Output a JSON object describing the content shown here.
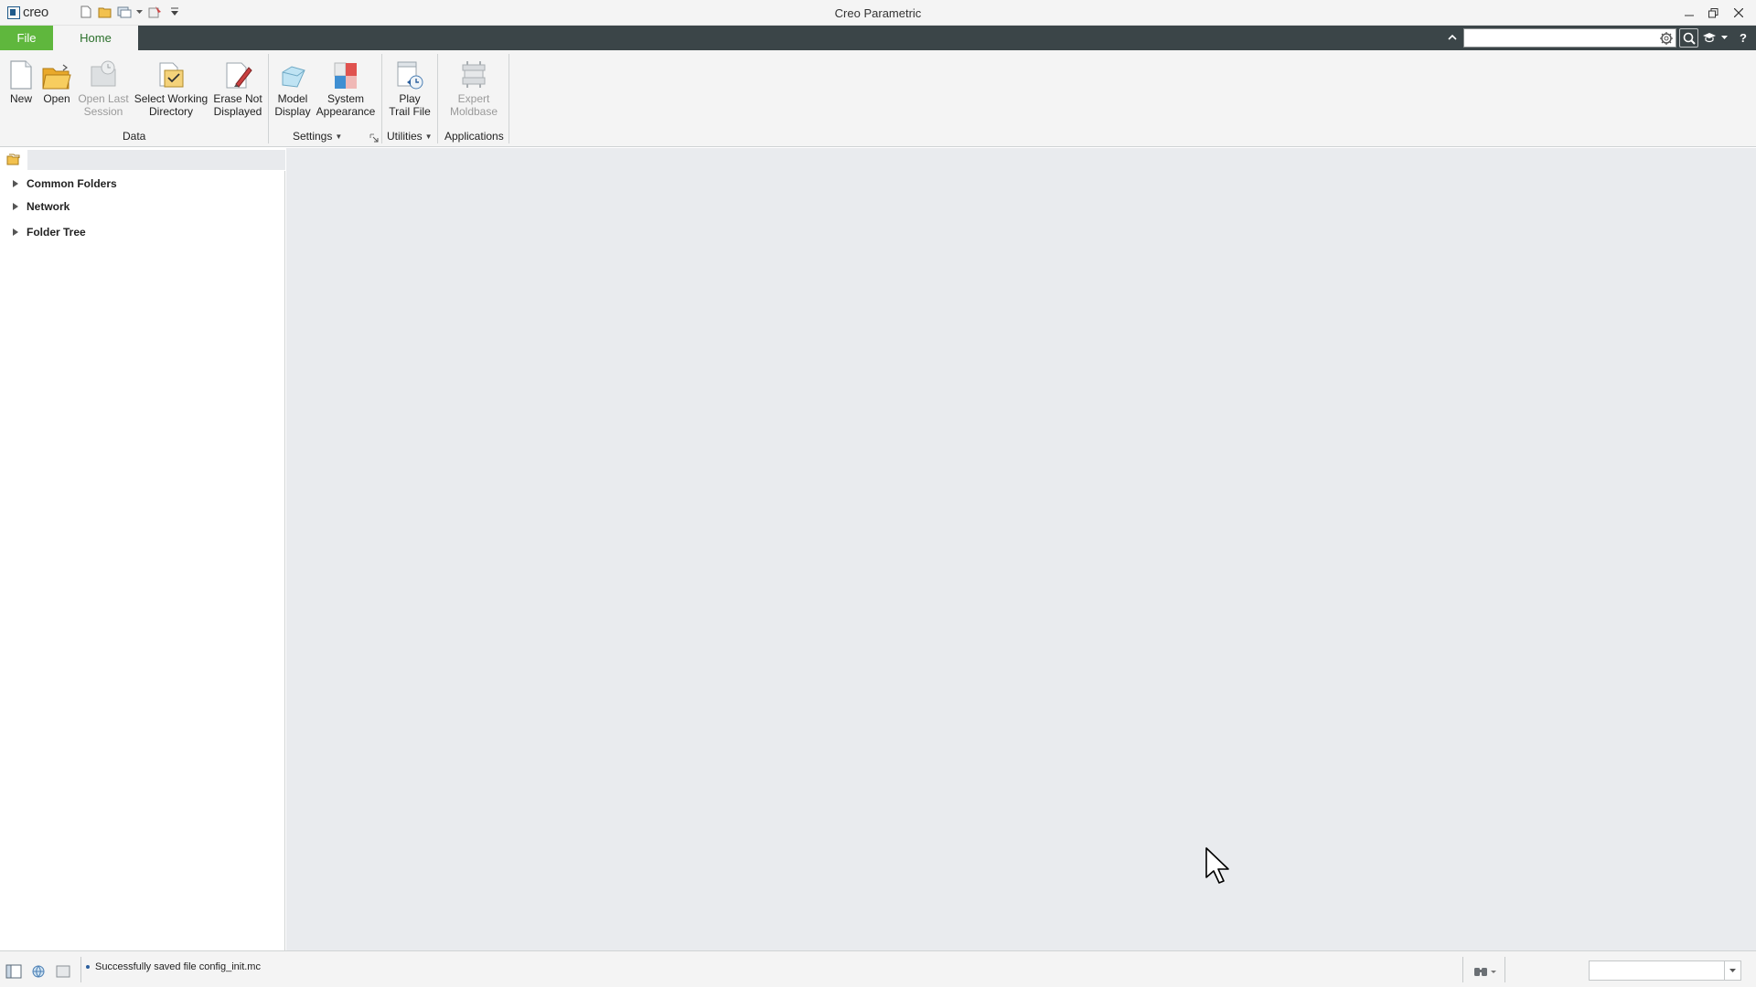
{
  "app": {
    "logo_text": "creo",
    "title": "Creo Parametric"
  },
  "quick_access": {
    "icons": [
      "new-file-icon",
      "open-folder-icon",
      "window-icon",
      "regenerate-icon",
      "customize-dropdown-icon"
    ]
  },
  "ribbon_tabs": {
    "file": "File",
    "home": "Home"
  },
  "search": {
    "value": "",
    "placeholder": ""
  },
  "ribbon": {
    "data_group": {
      "label": "Data",
      "new": "New",
      "open": "Open",
      "open_last_line1": "Open Last",
      "open_last_line2": "Session",
      "select_wd_line1": "Select Working",
      "select_wd_line2": "Directory",
      "erase_line1": "Erase Not",
      "erase_line2": "Displayed"
    },
    "settings_group": {
      "label": "Settings",
      "model_display_line1": "Model",
      "model_display_line2": "Display",
      "system_appearance_line1": "System",
      "system_appearance_line2": "Appearance"
    },
    "utilities_group": {
      "label": "Utilities",
      "play_trail_line1": "Play",
      "play_trail_line2": "Trail File"
    },
    "applications_group": {
      "label": "Applications",
      "expert_moldbase_line1": "Expert",
      "expert_moldbase_line2": "Moldbase"
    }
  },
  "navigator": {
    "items": [
      {
        "label": "Common Folders"
      },
      {
        "label": "Network"
      },
      {
        "label": "Folder Tree"
      }
    ]
  },
  "statusbar": {
    "message": "Successfully saved file config_init.mc",
    "filter_value": ""
  },
  "colors": {
    "file_tab": "#5fb73d",
    "tab_bar": "#3b4548",
    "main_background": "#e9ebee"
  }
}
